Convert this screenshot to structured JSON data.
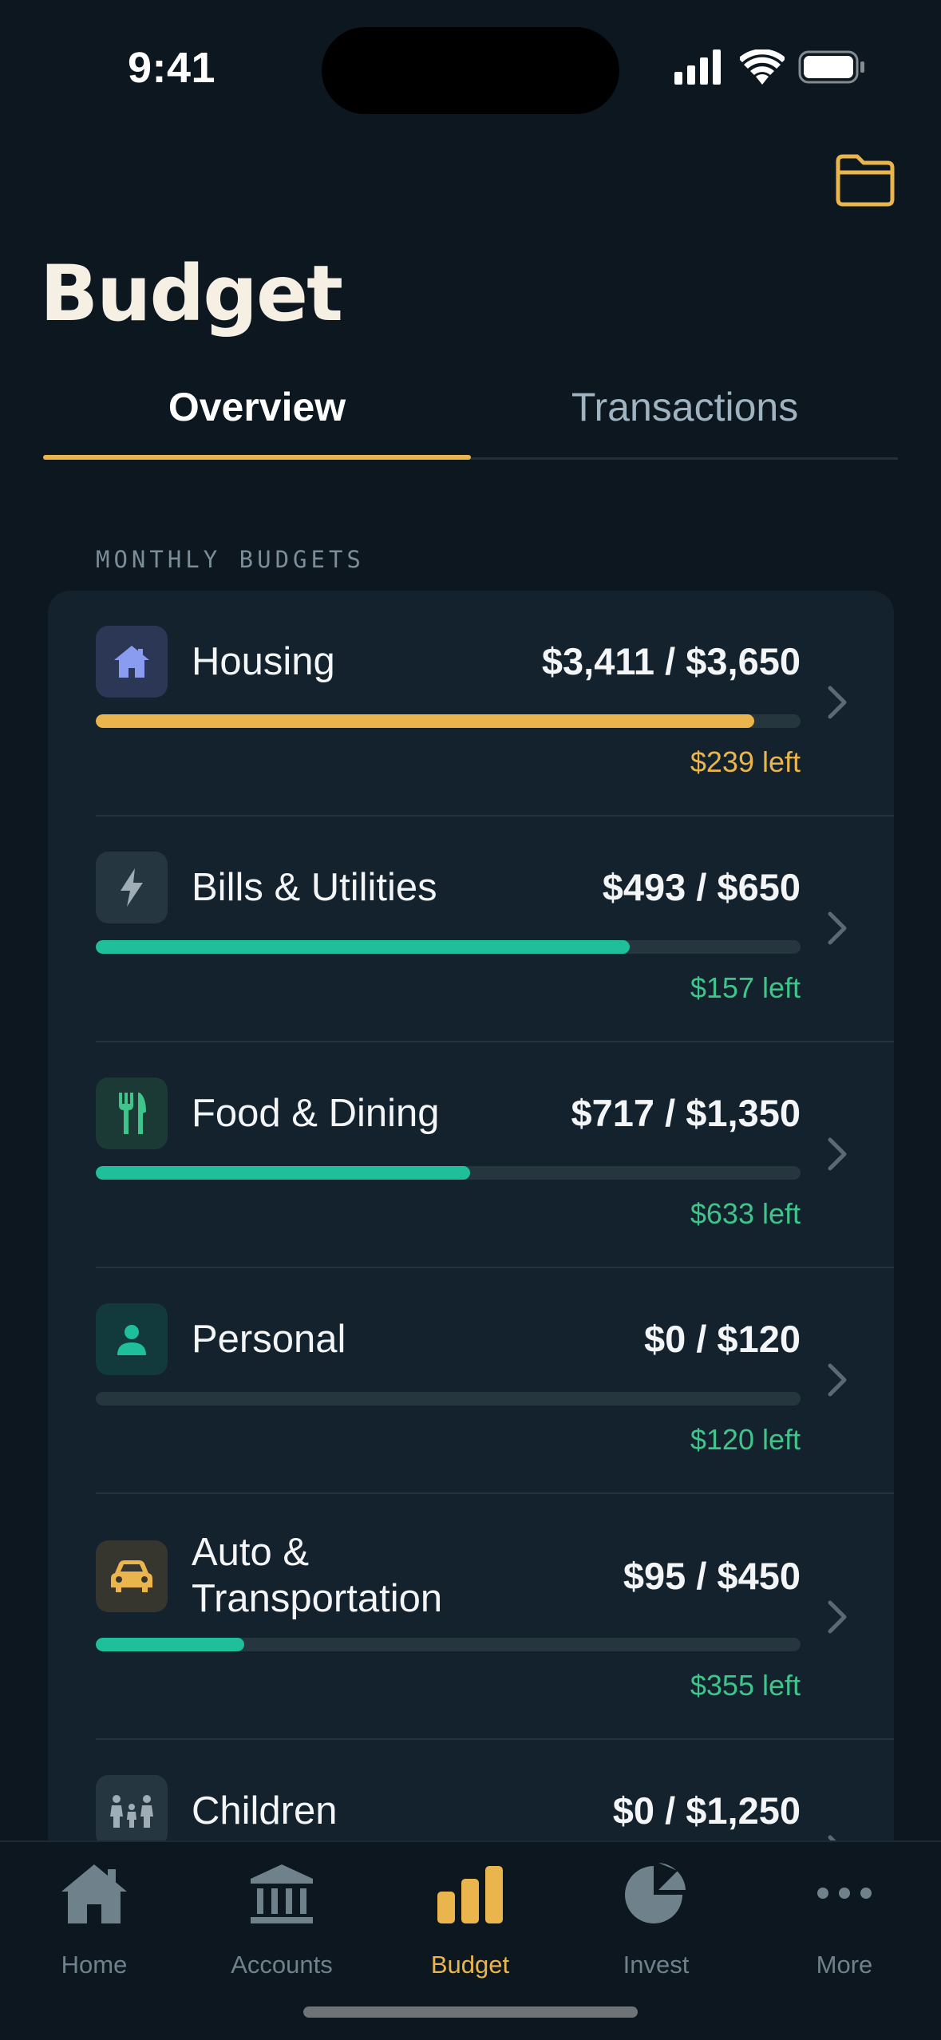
{
  "status_bar": {
    "time": "9:41"
  },
  "header": {
    "title": "Budget"
  },
  "tabs": [
    {
      "label": "Overview",
      "active": true
    },
    {
      "label": "Transactions",
      "active": false
    }
  ],
  "section_label": "MONTHLY BUDGETS",
  "budgets": [
    {
      "name": "Housing",
      "amount": "$3,411 / $3,650",
      "progress": 0.934,
      "left": "$239 left",
      "icon": "house-icon",
      "icon_color": "#8a9cf0",
      "icon_bg": "#2b3755",
      "bar_color": "#eab54d",
      "left_color": "#eab54d"
    },
    {
      "name": "Bills & Utilities",
      "amount": "$493 / $650",
      "progress": 0.758,
      "left": "$157 left",
      "icon": "bolt-icon",
      "icon_color": "#9eadb6",
      "icon_bg": "#263640",
      "bar_color": "#1fbf9c",
      "left_color": "#3fc48a"
    },
    {
      "name": "Food & Dining",
      "amount": "$717 / $1,350",
      "progress": 0.531,
      "left": "$633 left",
      "icon": "utensils-icon",
      "icon_color": "#3fc48a",
      "icon_bg": "#1b3a36",
      "bar_color": "#1fbf9c",
      "left_color": "#3fc48a"
    },
    {
      "name": "Personal",
      "amount": "$0 / $120",
      "progress": 0.0,
      "left": "$120 left",
      "icon": "person-icon",
      "icon_color": "#1fbf9c",
      "icon_bg": "#123a3c",
      "bar_color": "#1fbf9c",
      "left_color": "#3fc48a"
    },
    {
      "name": "Auto & Transportation",
      "name_lines": [
        "Auto &",
        "Transportation"
      ],
      "amount": "$95 / $450",
      "progress": 0.211,
      "left": "$355 left",
      "icon": "car-icon",
      "icon_color": "#eab54d",
      "icon_bg": "#36362e",
      "bar_color": "#1fbf9c",
      "left_color": "#3fc48a"
    },
    {
      "name": "Children",
      "amount": "$0 / $1,250",
      "progress": 0.0,
      "left": "",
      "icon": "family-icon",
      "icon_color": "#9eadb6",
      "icon_bg": "#263640",
      "bar_color": "#1fbf9c",
      "left_color": "#3fc48a"
    }
  ],
  "tabbar": [
    {
      "label": "Home",
      "icon": "home-icon",
      "active": false
    },
    {
      "label": "Accounts",
      "icon": "bank-icon",
      "active": false
    },
    {
      "label": "Budget",
      "icon": "bar-chart-icon",
      "active": true
    },
    {
      "label": "Invest",
      "icon": "pie-chart-icon",
      "active": false
    },
    {
      "label": "More",
      "icon": "more-icon",
      "active": false
    }
  ],
  "colors": {
    "accent": "#eab54d",
    "teal": "#1fbf9c",
    "background": "#0c1720",
    "card": "#13222d"
  }
}
